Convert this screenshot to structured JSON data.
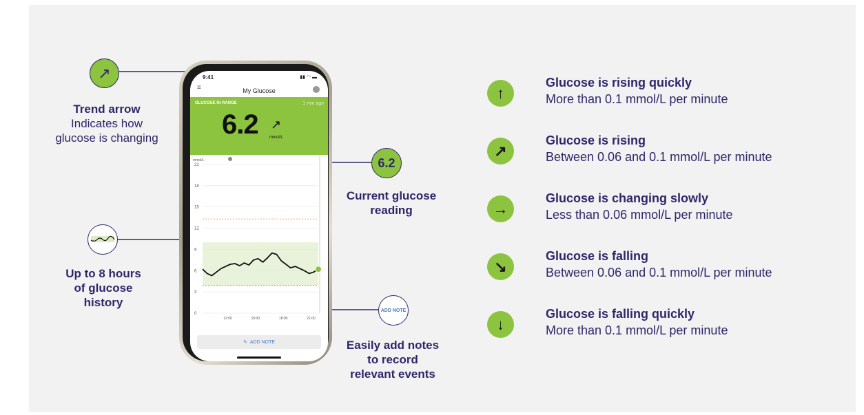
{
  "phone": {
    "status_time": "9:41",
    "app_title": "My Glucose",
    "band_label": "GLUCOSE IN RANGE",
    "band_time": "1 min ago",
    "reading": "6.2",
    "unit": "mmol/L",
    "chart_unit": "mmol/L",
    "add_note": "ADD NOTE"
  },
  "chart_data": {
    "type": "line",
    "ylabel": "mmol/L",
    "yticks": [
      0,
      3,
      6,
      9,
      12,
      15,
      18,
      21
    ],
    "xticks": [
      "12:00",
      "15:00",
      "18:00",
      "21:00"
    ],
    "ylim": [
      0,
      21
    ],
    "target_range": [
      3.9,
      10
    ],
    "high_line": 13.3,
    "low_line": 3.9,
    "x_hours": [
      9.3,
      9.8,
      10.3,
      10.8,
      11.3,
      11.8,
      12.3,
      12.8,
      13.3,
      13.8,
      14.3,
      14.8,
      15.3,
      15.8,
      16.3,
      16.8,
      17.3,
      17.8,
      18.3,
      18.8,
      19.3,
      19.8,
      20.3,
      20.8,
      21.3,
      21.8
    ],
    "values": [
      6.2,
      5.6,
      5.3,
      5.8,
      6.3,
      6.6,
      6.9,
      7.0,
      6.7,
      7.1,
      6.8,
      7.5,
      7.7,
      7.2,
      7.8,
      8.5,
      8.3,
      7.4,
      6.9,
      6.4,
      6.6,
      6.3,
      6.0,
      5.6,
      5.8,
      6.2
    ],
    "grid": true
  },
  "callouts": {
    "trend_icon": "↗",
    "trend_title": "Trend arrow",
    "trend_desc_1": "Indicates how",
    "trend_desc_2": "glucose is changing",
    "reading_icon": "6.2",
    "reading_title_1": "Current glucose",
    "reading_title_2": "reading",
    "history_title_1": "Up to 8 hours",
    "history_title_2": "of glucose",
    "history_title_3": "history",
    "note_icon": "ADD NOTE",
    "note_title_1": "Easily add notes",
    "note_title_2": "to record",
    "note_title_3": "relevant events"
  },
  "legend": [
    {
      "icon": "up-arrow-icon",
      "glyph": "↑",
      "title": "Glucose is rising quickly",
      "desc": "More than 0.1 mmol/L per minute"
    },
    {
      "icon": "up-right-arrow-icon",
      "glyph": "↗",
      "title": "Glucose is rising",
      "desc": "Between 0.06 and 0.1 mmol/L per minute"
    },
    {
      "icon": "right-arrow-icon",
      "glyph": "→",
      "title": "Glucose is changing slowly",
      "desc": "Less than 0.06 mmol/L per minute"
    },
    {
      "icon": "down-right-arrow-icon",
      "glyph": "↘",
      "title": "Glucose is falling",
      "desc": "Between 0.06 and 0.1 mmol/L per minute"
    },
    {
      "icon": "down-arrow-icon",
      "glyph": "↓",
      "title": "Glucose is falling quickly",
      "desc": "More than 0.1 mmol/L per minute"
    }
  ],
  "colors": {
    "accent": "#8cc43f",
    "navy": "#2d2768",
    "panel": "#f2f2f2"
  }
}
